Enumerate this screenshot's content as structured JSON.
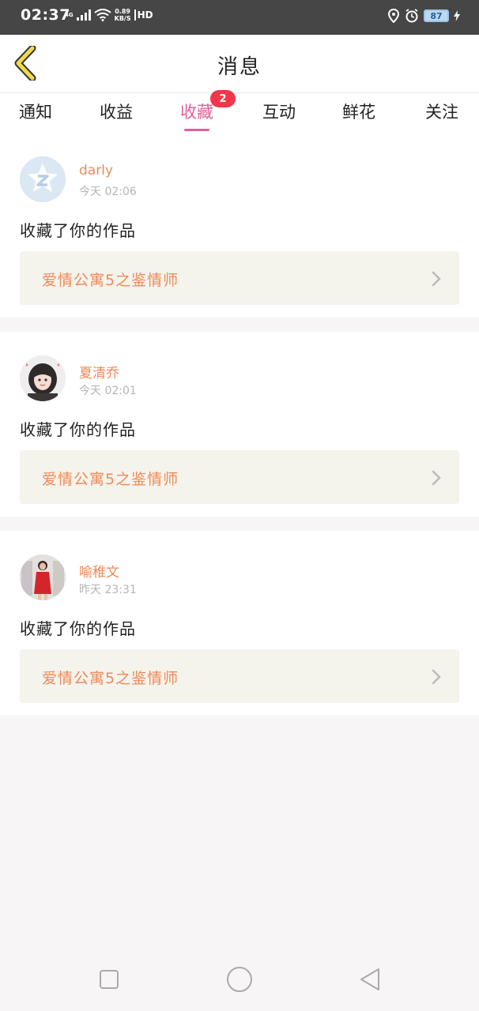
{
  "status_bar": {
    "time": "02:37",
    "network": "4G",
    "speed_value": "0.89",
    "speed_unit": "KB/S",
    "hd": "HD",
    "battery": "87"
  },
  "header": {
    "title": "消息"
  },
  "tabs": [
    {
      "label": "通知",
      "active": false
    },
    {
      "label": "收益",
      "active": false
    },
    {
      "label": "收藏",
      "active": true,
      "badge": "2"
    },
    {
      "label": "互动",
      "active": false
    },
    {
      "label": "鲜花",
      "active": false
    },
    {
      "label": "关注",
      "active": false
    }
  ],
  "messages": [
    {
      "user": "darly",
      "time": "今天 02:06",
      "text": "收藏了你的作品",
      "work_title": "爱情公寓5之鉴情师"
    },
    {
      "user": "夏清乔",
      "time": "今天 02:01",
      "text": "收藏了你的作品",
      "work_title": "爱情公寓5之鉴情师"
    },
    {
      "user": "喻稚文",
      "time": "昨天 23:31",
      "text": "收藏了你的作品",
      "work_title": "爱情公寓5之鉴情师"
    }
  ],
  "colors": {
    "accent": "#e0619a",
    "name_orange": "#f08a58",
    "badge_red": "#f2374a",
    "back_arrow": "#f2d94b"
  }
}
